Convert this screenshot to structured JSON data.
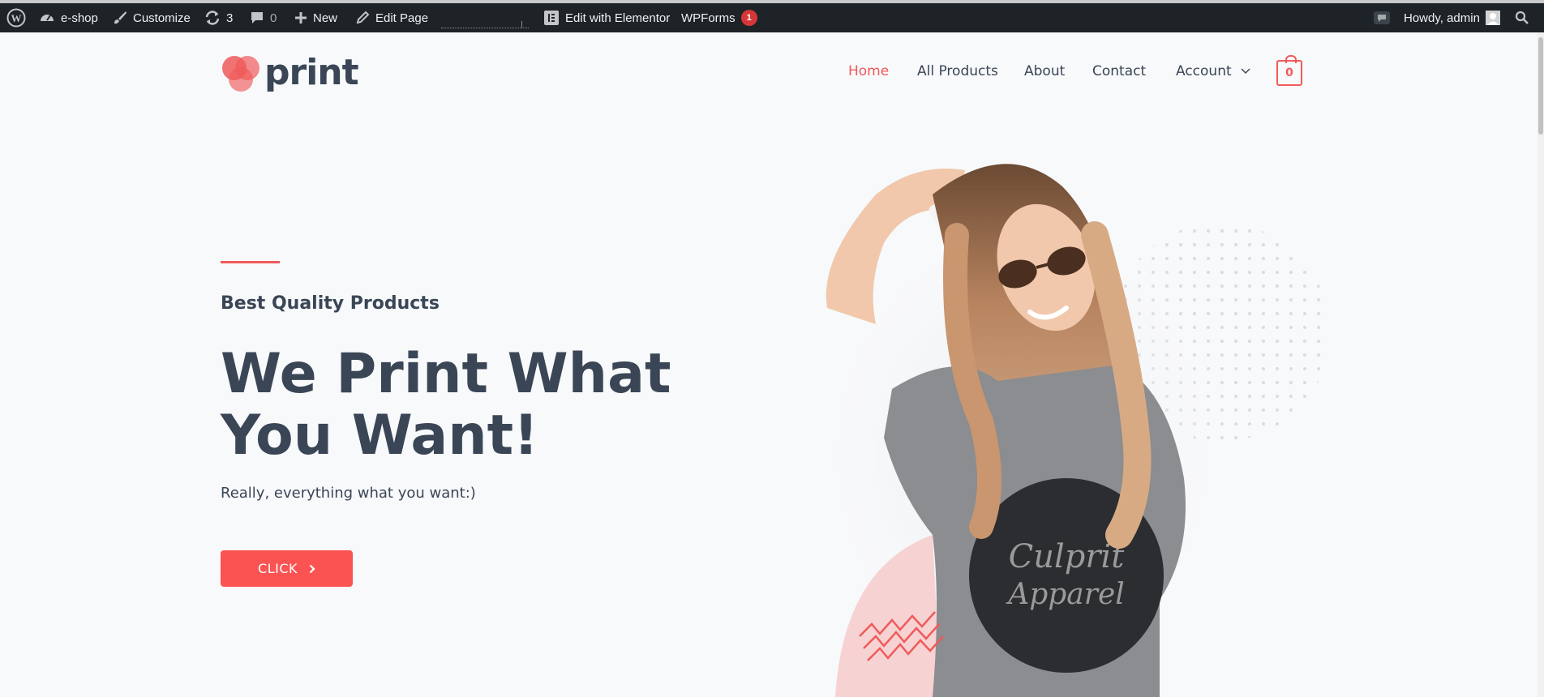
{
  "adminbar": {
    "site_name": "e-shop",
    "customize": "Customize",
    "updates_count": "3",
    "comments_count": "0",
    "new_label": "New",
    "edit_page": "Edit Page",
    "elementor": "Edit with Elementor",
    "wpforms": "WPForms",
    "wpforms_badge": "1",
    "howdy": "Howdy, admin"
  },
  "header": {
    "logo_text": "print",
    "nav": [
      "Home",
      "All Products",
      "About",
      "Contact",
      "Account"
    ],
    "cart_count": "0"
  },
  "hero": {
    "subtitle": "Best Quality Products",
    "title": "We Print What You Want!",
    "description": "Really, everything what you want:)",
    "button": "CLICK"
  },
  "colors": {
    "accent": "#f05a5a",
    "text": "#3a4656",
    "adminbar": "#1d2327"
  }
}
